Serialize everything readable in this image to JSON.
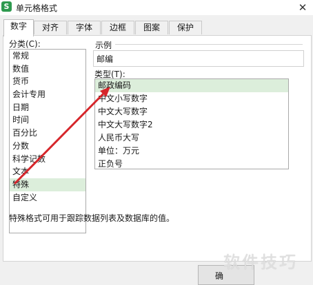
{
  "window": {
    "title": "单元格格式",
    "app_icon_letter": "S",
    "close_glyph": "✕"
  },
  "tabs": [
    {
      "label": "数字",
      "active": true
    },
    {
      "label": "对齐",
      "active": false
    },
    {
      "label": "字体",
      "active": false
    },
    {
      "label": "边框",
      "active": false
    },
    {
      "label": "图案",
      "active": false
    },
    {
      "label": "保护",
      "active": false
    }
  ],
  "category": {
    "label": "分类(C):",
    "items": [
      "常规",
      "数值",
      "货币",
      "会计专用",
      "日期",
      "时间",
      "百分比",
      "分数",
      "科学记数",
      "文本",
      "特殊",
      "自定义"
    ],
    "selected": "特殊"
  },
  "sample": {
    "label": "示例",
    "value": "邮编"
  },
  "type": {
    "label": "类型(T):",
    "items": [
      "邮政编码",
      "中文小写数字",
      "中文大写数字",
      "中文大写数字2",
      "人民币大写",
      "单位：万元",
      "正负号"
    ],
    "selected": "邮政编码"
  },
  "description": "特殊格式可用于跟踪数据列表及数据库的值。",
  "buttons": {
    "ok_label": "确"
  },
  "watermark": "软件技巧",
  "colors": {
    "selection": "#dceedb",
    "arrow": "#d6262b",
    "app_icon": "#2e9a4f"
  }
}
